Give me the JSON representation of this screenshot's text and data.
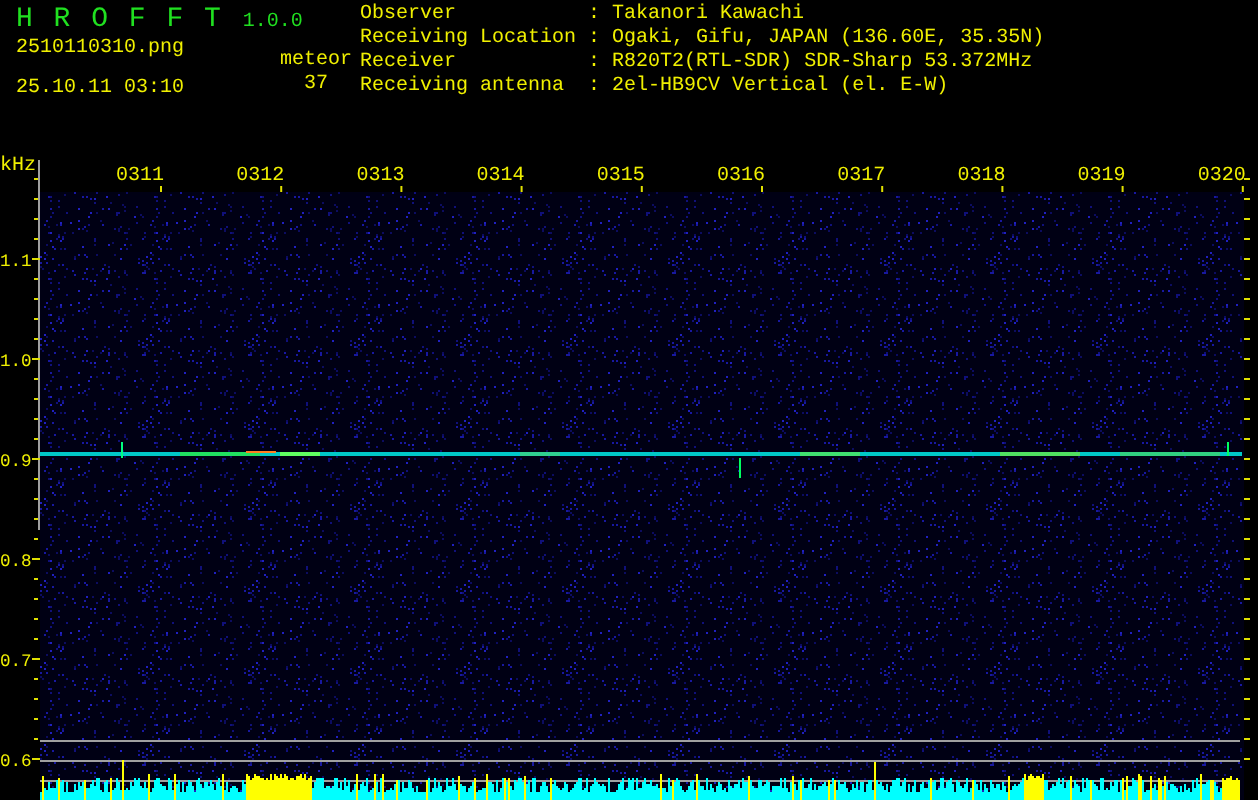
{
  "app": {
    "name": "H R O F F T",
    "version": "1.0.0"
  },
  "file": "2510110310.png",
  "timestamp": "25.10.11 03:10",
  "meteor": {
    "label": "meteor",
    "count": "37"
  },
  "info": {
    "separator": ":",
    "rows": [
      {
        "label": "Observer",
        "value": "Takanori Kawachi"
      },
      {
        "label": "Receiving Location",
        "value": "Ogaki, Gifu, JAPAN (136.60E, 35.35N)"
      },
      {
        "label": "Receiver",
        "value": "R820T2(RTL-SDR) SDR-Sharp 53.372MHz"
      },
      {
        "label": "Receiving antenna",
        "value": "2el-HB9CV Vertical (el. E-W)"
      }
    ]
  },
  "plot": {
    "unit": "kHz",
    "y_ticks": [
      "1.1",
      "1.0",
      "0.9",
      "0.8",
      "0.7",
      "0.6"
    ],
    "time_labels": [
      "0311",
      "0312",
      "0313",
      "0314",
      "0315",
      "0316",
      "0317",
      "0318",
      "0319",
      "0320"
    ]
  }
}
